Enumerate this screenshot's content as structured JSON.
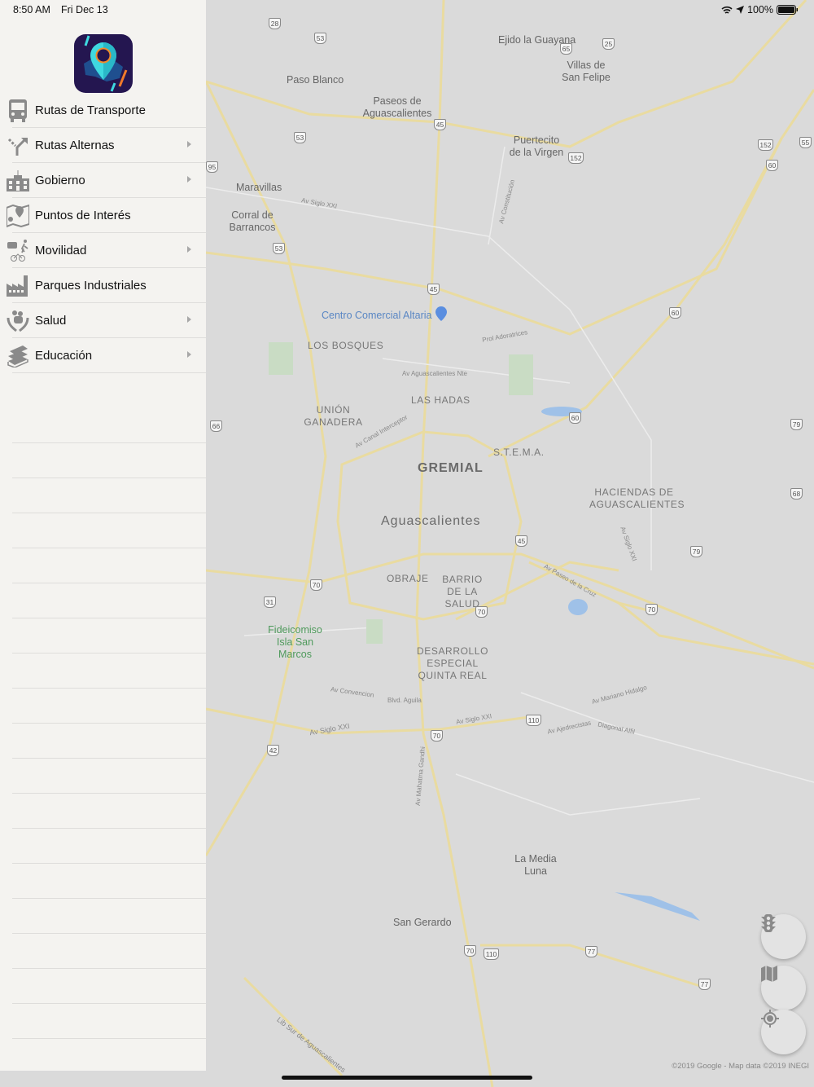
{
  "status_bar": {
    "time": "8:50 AM",
    "date": "Fri Dec 13",
    "battery": "100%",
    "icons": [
      "wifi-icon",
      "location-arrow-icon",
      "battery-icon"
    ]
  },
  "app": {
    "logo": "location-pin-logo"
  },
  "menu": {
    "items": [
      {
        "label": "Rutas de Transporte",
        "icon": "bus-icon",
        "has_submenu": false
      },
      {
        "label": "Rutas Alternas",
        "icon": "alternate-route-icon",
        "has_submenu": true
      },
      {
        "label": "Gobierno",
        "icon": "government-building-icon",
        "has_submenu": true
      },
      {
        "label": "Puntos de Interés",
        "icon": "map-pin-icon",
        "has_submenu": false
      },
      {
        "label": "Movilidad",
        "icon": "mobility-icon",
        "has_submenu": true
      },
      {
        "label": "Parques Industriales",
        "icon": "factory-icon",
        "has_submenu": false
      },
      {
        "label": "Salud",
        "icon": "health-hands-icon",
        "has_submenu": true
      },
      {
        "label": "Educación",
        "icon": "books-icon",
        "has_submenu": true
      }
    ]
  },
  "map": {
    "labels": [
      "Ejido la Guayana",
      "Villas de San Felipe",
      "Paso Blanco",
      "Paseos de Aguascalientes",
      "Puertecito de la Virgen",
      "Maravillas",
      "Corral de Barrancos",
      "Centro Comercial Altaria",
      "LOS BOSQUES",
      "LAS HADAS",
      "UNIÓN GANADERA",
      "S.T.E.M.A.",
      "GREMIAL",
      "HACIENDAS DE AGUASCALIENTES",
      "Aguascalientes",
      "OBRAJE",
      "BARRIO DE LA SALUD",
      "Fideicomiso Isla San Marcos",
      "DESARROLLO ESPECIAL QUINTA REAL",
      "La Media Luna",
      "San Gerardo",
      "Av Siglo XXI",
      "Av Siglo XXI",
      "Av Aguascalientes Nte",
      "Prol Adoratrices",
      "Av Constitución",
      "Av Convencion",
      "Blvd. Aguila",
      "Av Siglo XXI",
      "Av Mariano Hidalgo",
      "Av Ajedrecistas",
      "Diagonal Alfil",
      "Av Mahatma Gandhi",
      "Lib Sur de Aguascalientes",
      "Av Canal Interceptor",
      "Av Paseo de la Cruz",
      "Av Siglo XXI"
    ],
    "shields": [
      "28",
      "53",
      "65",
      "25",
      "45",
      "53",
      "152",
      "55",
      "60",
      "152",
      "95",
      "53",
      "45",
      "60",
      "79",
      "60",
      "68",
      "66",
      "45",
      "79",
      "70",
      "70",
      "31",
      "70",
      "110",
      "70",
      "42",
      "70",
      "110",
      "77",
      "77"
    ],
    "controls": [
      {
        "name": "traffic-button",
        "icon": "traffic-light-icon"
      },
      {
        "name": "map-type-button",
        "icon": "map-icon"
      },
      {
        "name": "my-location-button",
        "icon": "crosshair-icon"
      }
    ],
    "copyright": "©2019 Google - Map data ©2019 INEGI"
  }
}
